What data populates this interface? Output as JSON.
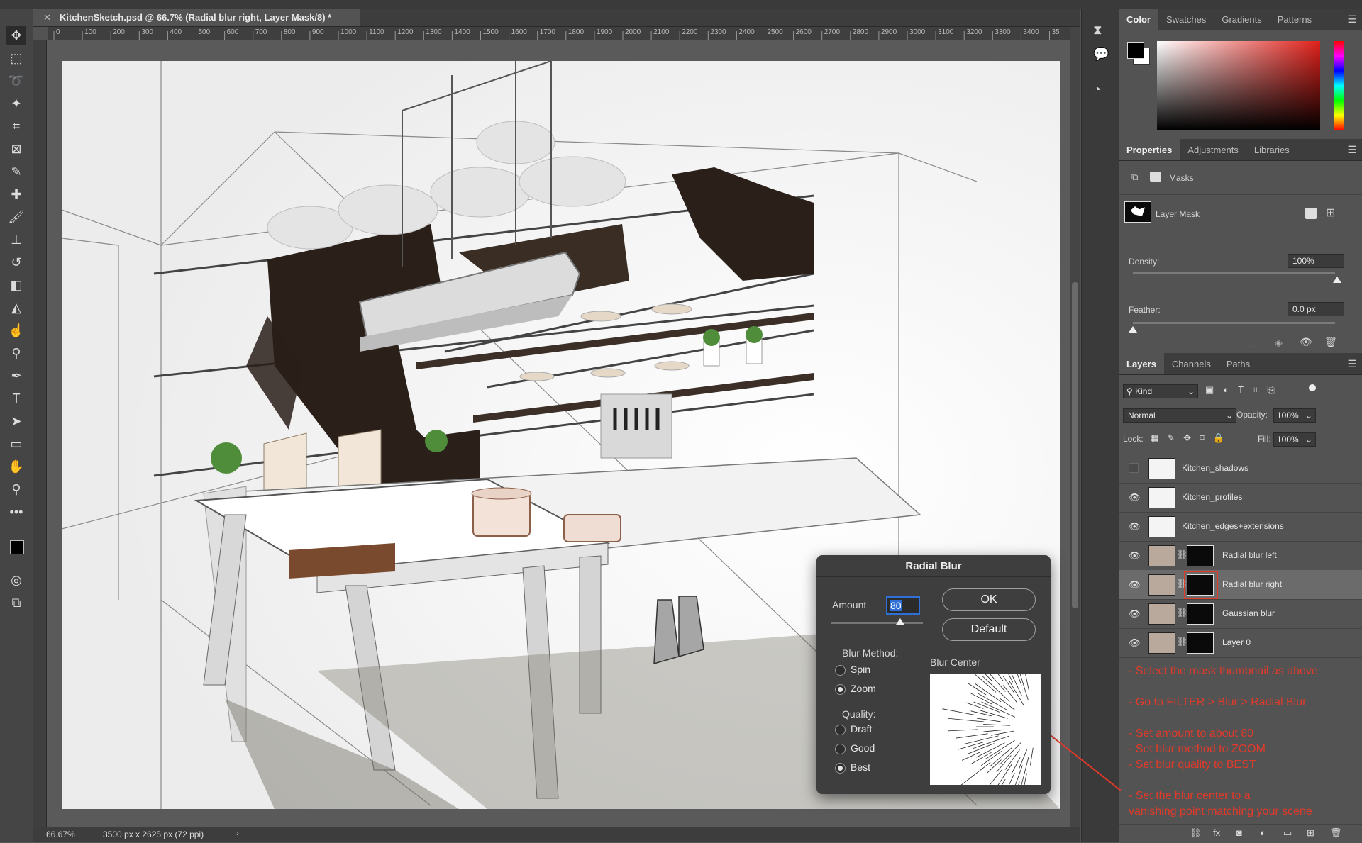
{
  "document": {
    "tab_title": "KitchenSketch.psd @ 66.7% (Radial blur right, Layer Mask/8) *",
    "ruler_ticks": [
      "0",
      "100",
      "200",
      "300",
      "400",
      "500",
      "600",
      "700",
      "800",
      "900",
      "1000",
      "1100",
      "1200",
      "1300",
      "1400",
      "1500",
      "1600",
      "1700",
      "1800",
      "1900",
      "2000",
      "2100",
      "2200",
      "2300",
      "2400",
      "2500",
      "2600",
      "2700",
      "2800",
      "2900",
      "3000",
      "3100",
      "3200",
      "3300",
      "3400",
      "35"
    ],
    "zoom": "66.67%",
    "doc_info": "3500 px x 2625 px (72 ppi)"
  },
  "color_panel": {
    "tabs": [
      "Color",
      "Swatches",
      "Gradients",
      "Patterns"
    ]
  },
  "properties_panel": {
    "tabs": [
      "Properties",
      "Adjustments",
      "Libraries"
    ],
    "section": "Masks",
    "mask_label": "Layer Mask",
    "density_label": "Density:",
    "density_value": "100%",
    "feather_label": "Feather:",
    "feather_value": "0.0 px"
  },
  "layers_panel": {
    "tabs": [
      "Layers",
      "Channels",
      "Paths"
    ],
    "kind_label": "Kind",
    "blend_mode": "Normal",
    "opacity_label": "Opacity:",
    "opacity_value": "100%",
    "lock_label": "Lock:",
    "fill_label": "Fill:",
    "fill_value": "100%",
    "layers": [
      {
        "name": "Kitchen_shadows",
        "visible": false
      },
      {
        "name": "Kitchen_profiles",
        "visible": true
      },
      {
        "name": "Kitchen_edges+extensions",
        "visible": true
      },
      {
        "name": "Radial blur left",
        "visible": true
      },
      {
        "name": "Radial blur right",
        "visible": true,
        "selected": true
      },
      {
        "name": "Gaussian blur",
        "visible": true
      },
      {
        "name": "Layer 0",
        "visible": true
      }
    ]
  },
  "instructions": [
    "- Select the mask thumbnail as above",
    "- Go to FILTER > Blur > Radial Blur",
    "- Set amount to about 80",
    "- Set blur method to ZOOM",
    "- Set blur quality to BEST",
    "- Set the blur center to a",
    "vanishing point matching your scene"
  ],
  "radial_blur_dialog": {
    "title": "Radial Blur",
    "amount_label": "Amount",
    "amount_value": "80",
    "ok_label": "OK",
    "default_label": "Default",
    "blur_method_label": "Blur Method:",
    "spin_label": "Spin",
    "zoom_label": "Zoom",
    "quality_label": "Quality:",
    "draft_label": "Draft",
    "good_label": "Good",
    "best_label": "Best",
    "blur_center_label": "Blur Center",
    "selected_method": "Zoom",
    "selected_quality": "Best"
  },
  "colors": {
    "panel_bg": "#535353",
    "dialog_bg": "#3e3e3e",
    "annotation_red": "#e23a2a",
    "selection_blue": "#2f6fd6"
  }
}
